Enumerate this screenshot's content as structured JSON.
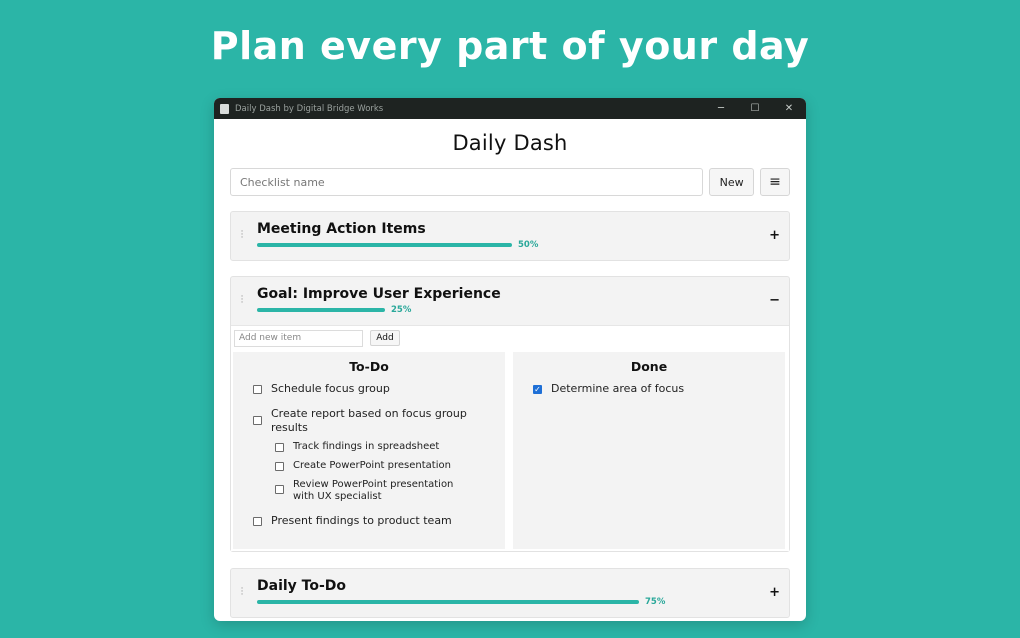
{
  "headline": "Plan every part of your day",
  "window": {
    "title": "Daily Dash by Digital Bridge Works",
    "controls": {
      "minimize": "─",
      "maximize": "☐",
      "close": "✕"
    }
  },
  "app_title": "Daily Dash",
  "toolbar": {
    "checklist_placeholder": "Checklist name",
    "new_label": "New",
    "menu_icon": "≡"
  },
  "checklists": [
    {
      "title": "Meeting Action Items",
      "progress_label": "50%",
      "progress": 0.5,
      "toggle": "+"
    },
    {
      "title": "Goal: Improve User Experience",
      "progress_label": "25%",
      "progress": 0.25,
      "toggle": "−",
      "add_item_placeholder": "Add new item",
      "add_label": "Add",
      "todo_title": "To-Do",
      "done_title": "Done",
      "todo": [
        {
          "label": "Schedule focus group"
        },
        {
          "label": "Create report based on focus group results",
          "subitems": [
            "Track findings in spreadsheet",
            "Create PowerPoint presentation",
            "Review PowerPoint presentation with UX specialist"
          ]
        },
        {
          "label": "Present findings to product team"
        }
      ],
      "done": [
        {
          "label": "Determine area of focus",
          "checked": true
        }
      ]
    },
    {
      "title": "Daily To-Do",
      "progress_label": "75%",
      "progress": 0.75,
      "toggle": "+"
    }
  ],
  "colors": {
    "accent": "#2bb5a7",
    "checkbox_checked": "#1e6fd6"
  }
}
